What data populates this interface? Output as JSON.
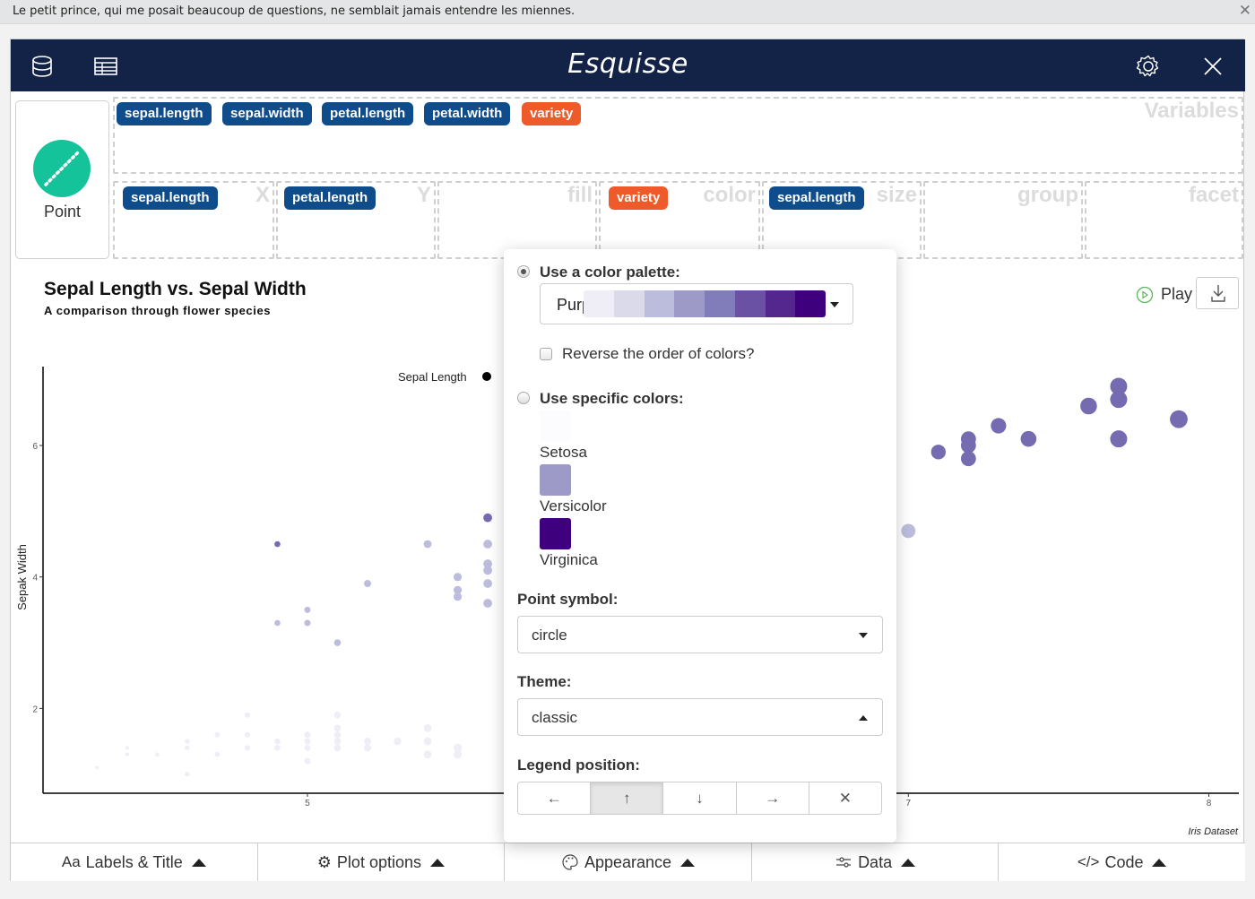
{
  "banner": {
    "message": "Le petit prince, qui me posait beaucoup de questions, ne semblait jamais entendre les miennes.",
    "close_icon": "close-icon"
  },
  "header": {
    "title": "Esquisse",
    "left_icons": [
      "database-icon",
      "table-icon"
    ],
    "right_icons": [
      "gear-icon",
      "close-icon"
    ]
  },
  "geom": {
    "label": "Point",
    "color": "#15c39a"
  },
  "variables": {
    "zone_label": "Variables",
    "items": [
      {
        "label": "sepal.length",
        "type": "numeric"
      },
      {
        "label": "sepal.width",
        "type": "numeric"
      },
      {
        "label": "petal.length",
        "type": "numeric"
      },
      {
        "label": "petal.width",
        "type": "numeric"
      },
      {
        "label": "variety",
        "type": "categorical"
      }
    ]
  },
  "aesthetics": [
    {
      "name": "X",
      "value": "sepal.length",
      "type": "numeric"
    },
    {
      "name": "Y",
      "value": "petal.length",
      "type": "numeric"
    },
    {
      "name": "fill",
      "value": null
    },
    {
      "name": "color",
      "value": "variety",
      "type": "categorical"
    },
    {
      "name": "size",
      "value": "sepal.length",
      "type": "numeric"
    },
    {
      "name": "group",
      "value": null
    },
    {
      "name": "facet",
      "value": null
    }
  ],
  "colors": {
    "numeric_badge": "#0f4c8c",
    "categorical_badge": "#ee5a2a",
    "header_bg": "#132347"
  },
  "plot_actions": {
    "play_label": "Play",
    "download_icon": "download-icon"
  },
  "popup": {
    "palette_option_label": "Use a color palette:",
    "palette_selected": true,
    "palette_name": "Purples",
    "palette_colors": [
      "#efedf5",
      "#dadaeb",
      "#bcbddc",
      "#9e9ac8",
      "#807dba",
      "#6a51a3",
      "#54278f",
      "#3f007d"
    ],
    "reverse_label": "Reverse the order of colors?",
    "reverse_checked": false,
    "specific_option_label": "Use specific colors:",
    "specific_selected": false,
    "specific_colors": [
      {
        "name": "Setosa",
        "color": "#fcfbfd"
      },
      {
        "name": "Versicolor",
        "color": "#9e9ac8"
      },
      {
        "name": "Virginica",
        "color": "#3f007d"
      }
    ],
    "point_symbol_label": "Point symbol:",
    "point_symbol_value": "circle",
    "theme_label": "Theme:",
    "theme_value": "classic",
    "legend_position_label": "Legend position:",
    "legend_positions": [
      {
        "name": "left",
        "glyph": "←",
        "active": false
      },
      {
        "name": "top",
        "glyph": "↑",
        "active": true
      },
      {
        "name": "bottom",
        "glyph": "↓",
        "active": false
      },
      {
        "name": "right",
        "glyph": "→",
        "active": false
      },
      {
        "name": "none",
        "glyph": "✕",
        "active": false
      }
    ]
  },
  "bottom_tabs": [
    {
      "label": "Labels & Title",
      "icon": "text-icon",
      "glyph": "Aa"
    },
    {
      "label": "Plot options",
      "icon": "gear-icon",
      "glyph": "⚙"
    },
    {
      "label": "Appearance",
      "icon": "palette-icon",
      "glyph": "🎨"
    },
    {
      "label": "Data",
      "icon": "sliders-icon",
      "glyph": "⚌"
    },
    {
      "label": "Code",
      "icon": "code-icon",
      "glyph": "</>"
    }
  ],
  "chart_data": {
    "type": "scatter",
    "title": "Sepal Length vs. Sepal Width",
    "subtitle": "A comparison through flower species",
    "xlabel": "",
    "ylabel": "Sepak Width",
    "caption": "Iris Dataset",
    "legend_title": "Sepal Length",
    "legend_position": "top",
    "xlim": [
      4.12,
      8.1
    ],
    "ylim": [
      0.71,
      7.2
    ],
    "xticks": [
      5,
      7,
      8
    ],
    "yticks": [
      2,
      4,
      6
    ],
    "grid": false,
    "series": [
      {
        "name": "setosa",
        "color": "#efedf5",
        "points": [
          [
            4.3,
            1.1
          ],
          [
            4.4,
            1.3
          ],
          [
            4.4,
            1.4
          ],
          [
            4.5,
            1.3
          ],
          [
            4.6,
            1.0
          ],
          [
            4.6,
            1.4
          ],
          [
            4.6,
            1.5
          ],
          [
            4.7,
            1.3
          ],
          [
            4.7,
            1.6
          ],
          [
            4.8,
            1.4
          ],
          [
            4.8,
            1.6
          ],
          [
            4.8,
            1.9
          ],
          [
            4.9,
            1.4
          ],
          [
            4.9,
            1.5
          ],
          [
            5.0,
            1.2
          ],
          [
            5.0,
            1.4
          ],
          [
            5.0,
            1.5
          ],
          [
            5.0,
            1.6
          ],
          [
            5.1,
            1.4
          ],
          [
            5.1,
            1.5
          ],
          [
            5.1,
            1.6
          ],
          [
            5.1,
            1.7
          ],
          [
            5.1,
            1.9
          ],
          [
            5.2,
            1.4
          ],
          [
            5.2,
            1.5
          ],
          [
            5.3,
            1.5
          ],
          [
            5.4,
            1.3
          ],
          [
            5.4,
            1.5
          ],
          [
            5.4,
            1.7
          ],
          [
            5.5,
            1.3
          ],
          [
            5.5,
            1.4
          ],
          [
            5.7,
            1.5
          ],
          [
            5.7,
            1.7
          ],
          [
            5.8,
            1.2
          ]
        ]
      },
      {
        "name": "versicolor",
        "color": "#bcbddc",
        "points": [
          [
            4.9,
            3.3
          ],
          [
            5.0,
            3.5
          ],
          [
            5.0,
            3.3
          ],
          [
            5.1,
            3.0
          ],
          [
            5.2,
            3.9
          ],
          [
            5.4,
            4.5
          ],
          [
            5.5,
            4.0
          ],
          [
            5.5,
            3.8
          ],
          [
            5.5,
            3.7
          ],
          [
            5.6,
            4.5
          ],
          [
            5.6,
            4.2
          ],
          [
            5.6,
            4.1
          ],
          [
            5.6,
            3.9
          ],
          [
            5.6,
            3.6
          ],
          [
            7.0,
            4.7
          ]
        ]
      },
      {
        "name": "virginica",
        "color": "#756bb1",
        "points": [
          [
            4.9,
            4.5
          ],
          [
            5.6,
            4.9
          ],
          [
            7.1,
            5.9
          ],
          [
            7.2,
            6.1
          ],
          [
            7.2,
            6.0
          ],
          [
            7.2,
            5.8
          ],
          [
            7.3,
            6.3
          ],
          [
            7.4,
            6.1
          ],
          [
            7.6,
            6.6
          ],
          [
            7.7,
            6.9
          ],
          [
            7.7,
            6.7
          ],
          [
            7.7,
            6.1
          ],
          [
            7.9,
            6.4
          ]
        ]
      }
    ]
  }
}
